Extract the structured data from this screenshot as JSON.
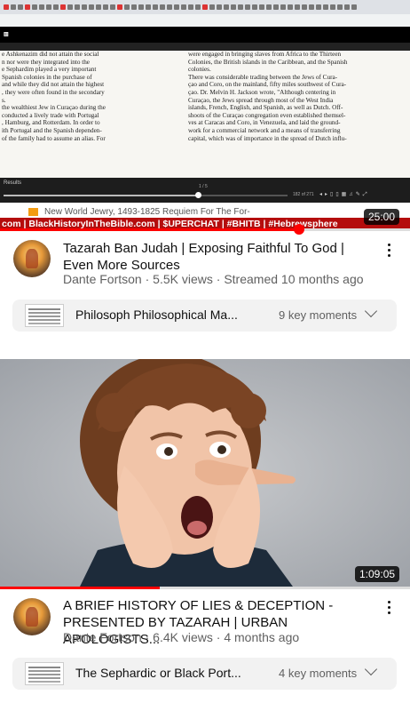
{
  "video1": {
    "ticker_text": "com | BlackHistoryInTheBible.com | $UPERCHAT | #BHITB | #Hebrewsphere",
    "overlay_title": "New World Jewry, 1493-1825 Requiem For The For-",
    "duration": "25:00",
    "progress_percent": 73,
    "book_left_lines": [
      "e Ashkenazim did not attain the social",
      "n nor were they integrated into the",
      "e Sephardim played a very important",
      "Spanish colonies in the purchase of",
      "and while they did not attain the highest",
      ", they were often found in the secondary",
      "s.",
      "the wealthiest Jew in Curaçao during the",
      "conducted a lively trade with Portugal",
      ", Hamburg, and Rotterdam. In order to",
      "ith Portugal and the Spanish dependen-",
      "of the family had to assume an alias. For"
    ],
    "book_right_lines": [
      "were engaged in bringing slaves from Africa to the Thirteen",
      "Colonies, the British islands in the Caribbean, and the Spanish",
      "colonies.",
      "There was considerable trading between the Jews of Cura-",
      "çao and Coro, on the mainland, fifty miles southwest of Cura-",
      "çao. Dr. Melvin H. Jackson wrote, \"Although centering in",
      "Curaçao, the Jews spread through most of the West India",
      "islands, French, English, and Spanish, as well as Dutch. Off-",
      "shoots of the Curaçao congregation even established themsel-",
      "ves at Caracas and Coro, in Venezuela, and laid the ground-",
      "work for a commercial network and a means of transferring",
      "capital, which was of importance in the spread of Dutch influ-"
    ],
    "reader_results": "Results",
    "reader_page": "1 / 5",
    "reader_count": "182 of 271",
    "title": "Tazarah Ban Judah | Exposing Faithful To God | Even More Sources",
    "channel": "Dante Fortson",
    "views": "5.5K views",
    "age": "Streamed 10 months ago",
    "moments_title": "Philosoph Philosophical Ma...",
    "moments_count": "9 key moments"
  },
  "video2": {
    "duration": "1:09:05",
    "progress_percent": 39,
    "title": "A BRIEF HISTORY OF LIES & DECEPTION - PRESENTED BY TAZARAH | URBAN APOLOGISTS...",
    "channel": "Dante Fortson",
    "views": "6.4K views",
    "age": "4 months ago",
    "moments_title": "The Sephardic or Black Port...",
    "moments_count": "4 key moments"
  },
  "separator": "·",
  "icons": [
    "more-vert-icon",
    "chevron-down-icon",
    "channel-avatar-icon"
  ],
  "colors": {
    "progress": "#ff0000",
    "ticker": "#b40d0d"
  }
}
